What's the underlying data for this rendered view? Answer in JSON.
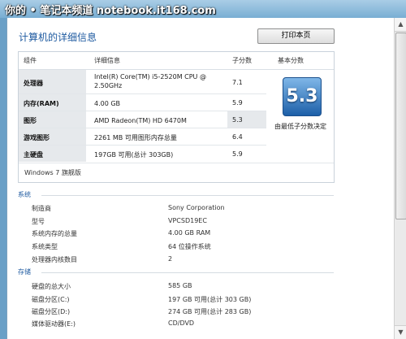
{
  "watermark": "你的 • 笔记本频道 notebook.it168.com",
  "header": {
    "title": "计算机的详细信息",
    "print_label": "打印本页"
  },
  "performance": {
    "columns": [
      "组件",
      "详细信息",
      "子分数",
      "基本分数"
    ],
    "rows": [
      {
        "component": "处理器",
        "detail_line1": "Intel(R) Core(TM) i5-2520M CPU @",
        "detail_line2": "2.50GHz",
        "subscore": "7.1"
      },
      {
        "component": "内存(RAM)",
        "detail_line1": "4.00 GB",
        "subscore": "5.9"
      },
      {
        "component": "图形",
        "detail_line1": "AMD Radeon(TM) HD 6470M",
        "subscore": "5.3"
      },
      {
        "component": "游戏图形",
        "detail_line1": "2261 MB 可用图形内存总量",
        "subscore": "6.4"
      },
      {
        "component": "主硬盘",
        "detail_line1": "197GB 可用(总计 303GB)",
        "subscore": "5.9"
      }
    ],
    "base_score": "5.3",
    "base_note": "由最低子分数决定",
    "edition": "Windows 7 旗舰版"
  },
  "system": {
    "heading": "系统",
    "items": [
      {
        "label": "制造商",
        "value": "Sony Corporation"
      },
      {
        "label": "型号",
        "value": "VPCSD19EC"
      },
      {
        "label": "系统内存的总量",
        "value": "4.00 GB RAM"
      },
      {
        "label": "系统类型",
        "value": "64 位操作系统"
      },
      {
        "label": "处理器内核数目",
        "value": "2"
      }
    ]
  },
  "storage": {
    "heading": "存储",
    "items": [
      {
        "label": "硬盘的总大小",
        "value": "585 GB"
      },
      {
        "label": "磁盘分区(C:)",
        "value": "197 GB 可用(总计 303 GB)"
      },
      {
        "label": "磁盘分区(D:)",
        "value": "274 GB 可用(总计 283 GB)"
      },
      {
        "label": "媒体驱动器(E:)",
        "value": "CD/DVD"
      }
    ]
  }
}
